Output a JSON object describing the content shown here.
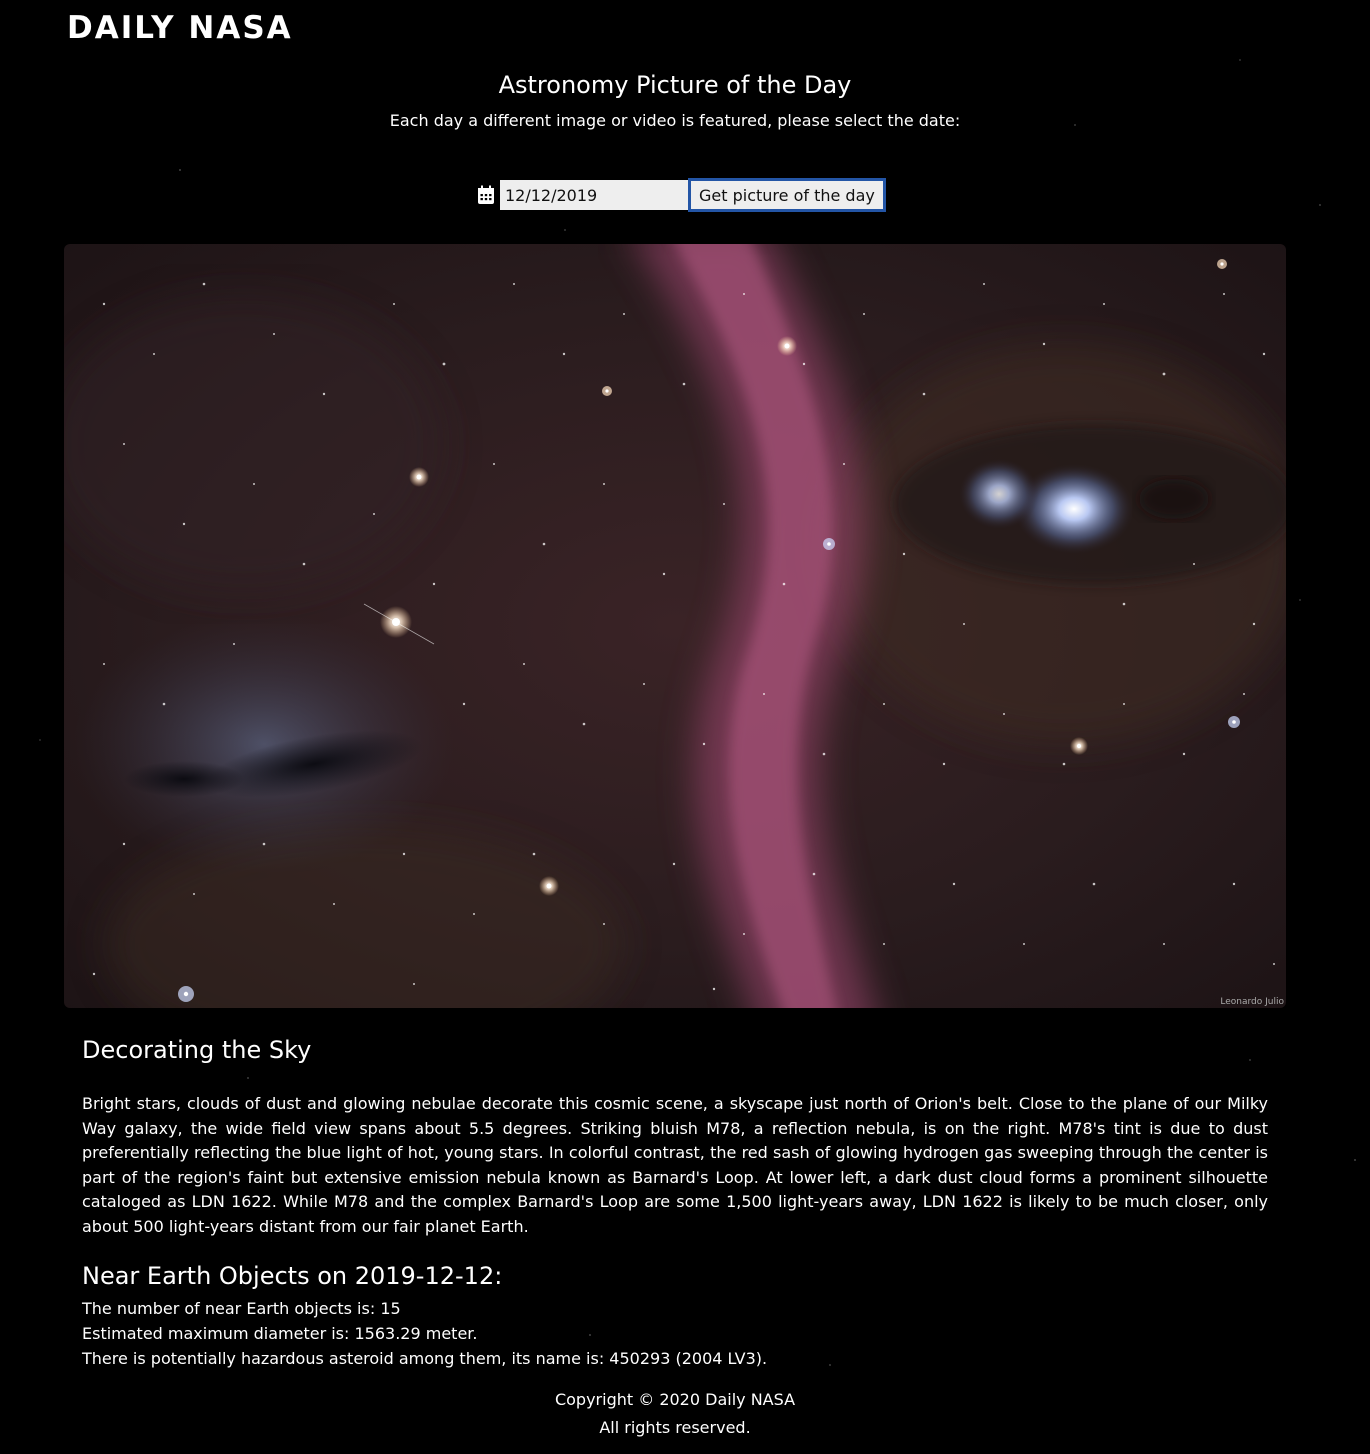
{
  "header": {
    "logo_text": "DAILY NASA"
  },
  "hero": {
    "title": "Astronomy Picture of the Day",
    "subtitle": "Each day a different image or video is featured, please select the date:"
  },
  "date_form": {
    "icon": "calendar-icon",
    "date_value": "12/12/2019",
    "submit_label": "Get picture of the day"
  },
  "apod": {
    "image_credit": "Leonardo Julio",
    "title": "Decorating the Sky",
    "explanation": "Bright stars, clouds of dust and glowing nebulae decorate this cosmic scene, a skyscape just north of Orion's belt. Close to the plane of our Milky Way galaxy, the wide field view spans about 5.5 degrees. Striking bluish M78, a reflection nebula, is on the right. M78's tint is due to dust preferentially reflecting the blue light of hot, young stars. In colorful contrast, the red sash of glowing hydrogen gas sweeping through the center is part of the region's faint but extensive emission nebula known as Barnard's Loop. At lower left, a dark dust cloud forms a prominent silhouette cataloged as LDN 1622. While M78 and the complex Barnard's Loop are some 1,500 light-years away, LDN 1622 is likely to be much closer, only about 500 light-years distant from our fair planet Earth."
  },
  "neo": {
    "heading": "Near Earth Objects on 2019-12-12:",
    "count_line": "The number of near Earth objects is: 15",
    "diameter_line": "Estimated maximum diameter is: 1563.29 meter.",
    "hazard_line": "There is potentially hazardous asteroid among them, its name is: 450293 (2004 LV3)."
  },
  "footer": {
    "copyright": "Copyright © 2020 Daily NASA",
    "rights": "All rights reserved."
  },
  "colors": {
    "background": "#000000",
    "text": "#ffffff",
    "button_border": "#2355a6",
    "input_bg": "#eeeeee"
  }
}
